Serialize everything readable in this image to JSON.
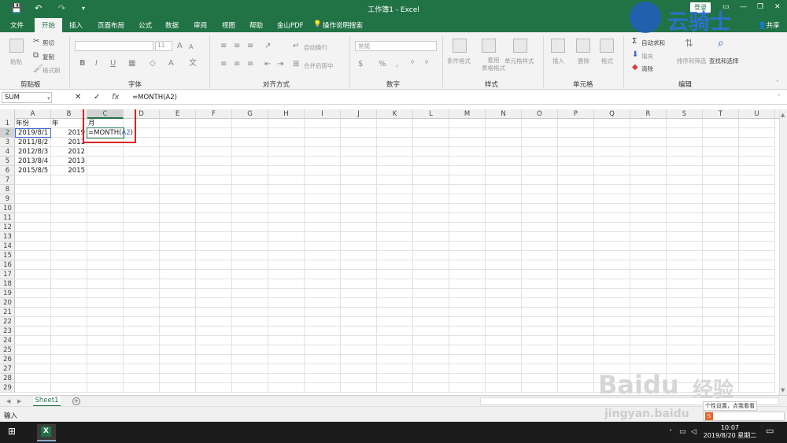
{
  "window": {
    "title": "工作簿1 - Excel",
    "login_label": "登录",
    "share_label": "共享"
  },
  "tabs": [
    "文件",
    "开始",
    "插入",
    "页面布局",
    "公式",
    "数据",
    "审阅",
    "视图",
    "帮助",
    "金山PDF"
  ],
  "active_tab": "开始",
  "tell_me": "操作说明搜索",
  "ribbon": {
    "clipboard": {
      "group": "剪贴板",
      "paste": "粘贴",
      "cut": "剪切",
      "copy": "复制",
      "format_painter": "格式刷"
    },
    "font": {
      "group": "字体",
      "size": "11",
      "bold": "B",
      "italic": "I",
      "underline": "U"
    },
    "alignment": {
      "group": "对齐方式",
      "wrap": "自动换行",
      "merge": "合并后居中"
    },
    "number": {
      "group": "数字",
      "format": "常规"
    },
    "styles": {
      "group": "样式",
      "cond": "条件格式",
      "table": "套用\n表格格式",
      "cell": "单元格样式"
    },
    "cells": {
      "group": "单元格",
      "insert": "插入",
      "delete": "删除",
      "format": "格式"
    },
    "editing": {
      "group": "编辑",
      "autosum": "自动求和",
      "fill": "填充",
      "clear": "清除",
      "sort": "排序和筛选",
      "find": "查找和选择"
    }
  },
  "formula_bar": {
    "name_box": "SUM",
    "cancel": "✕",
    "enter": "✓",
    "fx": "fx",
    "formula": "=MONTH(A2)"
  },
  "columns": [
    "A",
    "B",
    "C",
    "D",
    "E",
    "F",
    "G",
    "H",
    "I",
    "J",
    "K",
    "L",
    "M",
    "N",
    "O",
    "P",
    "Q",
    "R",
    "S",
    "T",
    "U"
  ],
  "selected_column": "C",
  "selected_row": 2,
  "rows": 29,
  "cells": {
    "A1": "年份",
    "B1": "年",
    "C1": "月",
    "A2": "2019/8/1",
    "B2": "2019",
    "C2": "=MONTH(A2)",
    "A3": "2011/8/2",
    "B3": "2011",
    "A4": "2012/8/3",
    "B4": "2012",
    "A5": "2013/8/4",
    "B5": "2013",
    "A6": "2015/8/5",
    "B6": "2015"
  },
  "sheet_tabs": [
    "Sheet1"
  ],
  "status": {
    "mode": "输入"
  },
  "taskbar": {
    "time": "10:07",
    "date": "2019/8/20 星期二"
  },
  "watermarks": {
    "brand": "云骑士",
    "baidu": "Baidu",
    "jingyan": "经验",
    "url": "jingyan.baidu",
    "tip": "个性设置，点我看看"
  },
  "colors": {
    "excel_green": "#217346",
    "highlight_red": "#e02020",
    "ref_blue": "#3a66c8"
  }
}
